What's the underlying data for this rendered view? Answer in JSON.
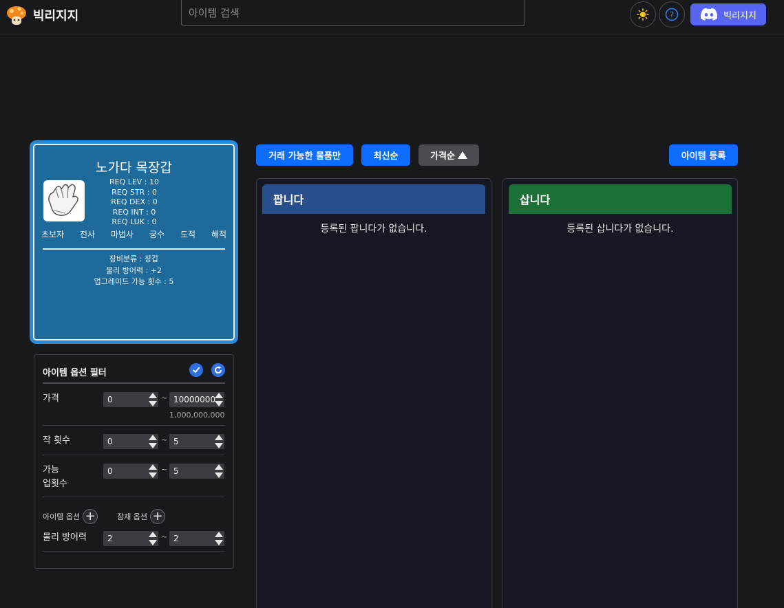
{
  "header": {
    "logo_text": "빅리지지",
    "search_placeholder": "아이템 검색",
    "discord_label": "빅리지지",
    "help_glyph": "?",
    "colors": {
      "discord": "#5865f2",
      "accent": "#0d6efd"
    }
  },
  "item": {
    "name": "노가다 목장갑",
    "req": [
      "REQ LEV : 10",
      "REQ STR : 0",
      "REQ DEX : 0",
      "REQ INT : 0",
      "REQ LUK : 0"
    ],
    "jobs": [
      "초보자",
      "전사",
      "마법사",
      "궁수",
      "도적",
      "해적"
    ],
    "info": [
      "장비분류 : 장갑",
      "물리 방어력 : +2",
      "업그레이드 가능 횟수 : 5"
    ],
    "icon": "white-glove-icon"
  },
  "filter": {
    "title": "아이템 옵션 필터",
    "price": {
      "label": "가격",
      "min": "0",
      "max": "10000000",
      "max_formatted": "1,000,000,000"
    },
    "scroll_count": {
      "label": "작 횟수",
      "min": "0",
      "max": "5"
    },
    "upgrade_count": {
      "label_line1": "가능",
      "label_line2": "업횟수",
      "min": "0",
      "max": "5"
    },
    "item_option_label": "아이템 옵션",
    "potential_option_label": "잠재 옵션",
    "physical_def": {
      "label": "물리 방어력",
      "min": "2",
      "max": "2"
    },
    "tilde": "~"
  },
  "toolbar": {
    "tradeable_only": "거래 가능한 물품만",
    "newest": "최신순",
    "price_sort": "가격순",
    "register_item": "아이템 등록"
  },
  "sell": {
    "title": "팝니다",
    "empty": "등록된 팝니다가 없습니다.",
    "color": "#284f8c"
  },
  "buy": {
    "title": "삽니다",
    "empty": "등록된 삽니다가 없습니다.",
    "color": "#1d7038"
  }
}
